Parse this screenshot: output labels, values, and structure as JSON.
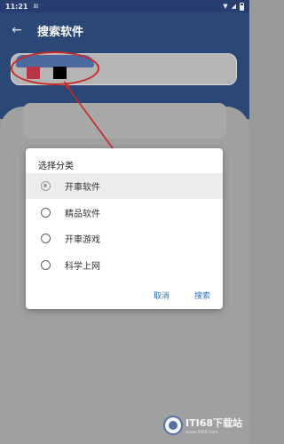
{
  "status_bar": {
    "time": "11:21",
    "notification_icon": "notification-icon",
    "icons": [
      "wifi-icon",
      "signal-icon",
      "battery-icon"
    ]
  },
  "app_bar": {
    "title": "搜索软件",
    "back_icon": "arrow-left-icon"
  },
  "dialog": {
    "title": "选择分类",
    "options": [
      {
        "label": "开車软件",
        "selected": true
      },
      {
        "label": "精品软件",
        "selected": false
      },
      {
        "label": "开車游戏",
        "selected": false
      },
      {
        "label": "科学上网",
        "selected": false
      }
    ],
    "cancel_label": "取消",
    "search_label": "搜索"
  },
  "watermark": {
    "main": "ITI68下载站",
    "sub": "www.iti68.com"
  },
  "colors": {
    "appbar": "#2b4776",
    "accent": "#2f6fbb",
    "annotation": "#c62828",
    "scrim": "#9a9a9a"
  }
}
